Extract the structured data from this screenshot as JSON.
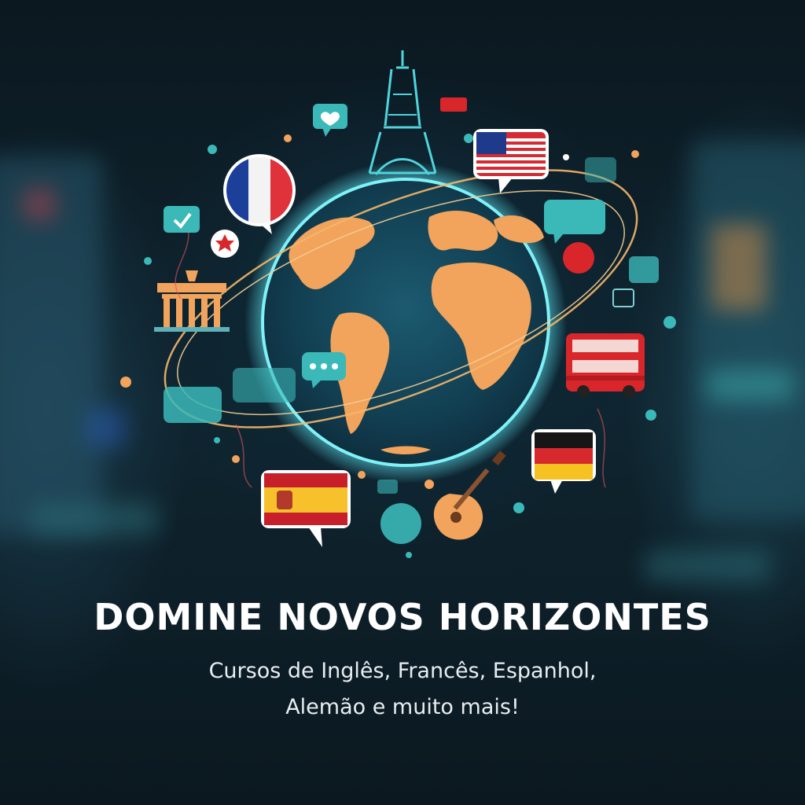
{
  "poster": {
    "headline": "DOMINE NOVOS HORIZONTES",
    "subtitle_line1": "Cursos de Inglês, Francês, Espanhol,",
    "subtitle_line2": "Alemão e muito mais!"
  },
  "illustration": {
    "elements": [
      "globe",
      "eiffel-tower",
      "brandenburg-gate",
      "london-bus",
      "guitar",
      "flag-france",
      "flag-usa",
      "flag-spain",
      "flag-germany",
      "speech-bubbles"
    ]
  },
  "colors": {
    "background": "#0c1a24",
    "globe_glow": "#5fe3f0",
    "continents": "#f2a35c",
    "orbit": "#f5b66a",
    "accent_teal": "#3bb8b8",
    "bus_red": "#d8262b"
  }
}
